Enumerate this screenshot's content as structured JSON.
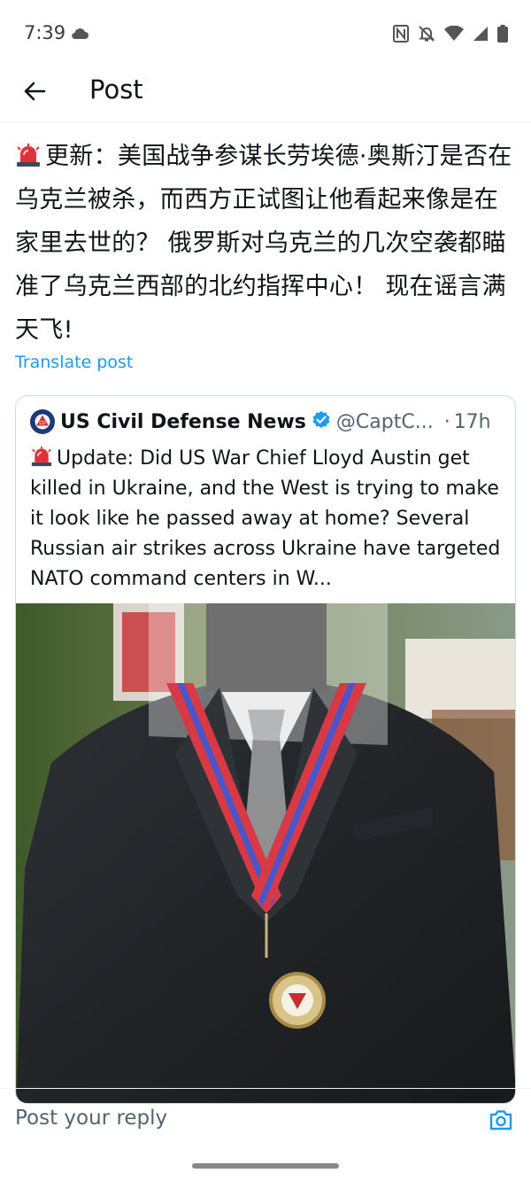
{
  "status_bar": {
    "time": "7:39",
    "icons": [
      "cloud-icon",
      "nfc-icon",
      "bell-off-icon",
      "wifi-icon",
      "signal-icon",
      "battery-icon"
    ]
  },
  "header": {
    "title": "Post",
    "back_icon": "arrow-left-icon"
  },
  "post": {
    "text": "更新：美国战争参谋长劳埃德·奥斯汀是否在乌克兰被杀，而西方正试图让他看起来像是在家里去世的？ 俄罗斯对乌克兰的几次空袭都瞄准了乌克兰西部的北约指挥中心！ 现在谣言满天飞!",
    "translate_label": "Translate post"
  },
  "quote": {
    "author_name": "US Civil Defense News",
    "handle": "@CaptC...",
    "separator": "·",
    "time": "17h",
    "text": "Update: Did US War Chief Lloyd Austin get killed in Ukraine, and the West is trying to make it look like he passed away at home? Several Russian air strikes across Ukraine have targeted NATO command centers in W..."
  },
  "reply": {
    "placeholder": "Post your reply"
  },
  "colors": {
    "link": "#1d9bf0",
    "verified": "#1d9bf0",
    "secondary_text": "#536471"
  }
}
